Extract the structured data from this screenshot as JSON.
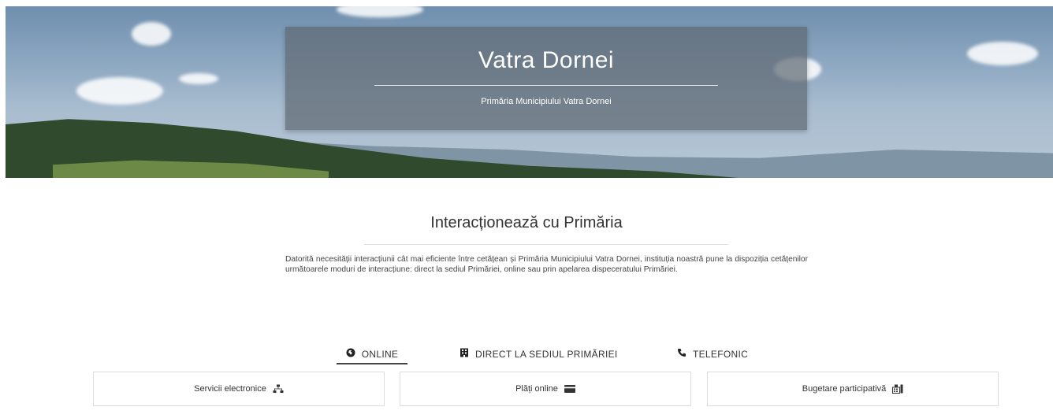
{
  "hero": {
    "title": "Vatra Dornei",
    "subtitle": "Primăria Municipiului Vatra Dornei"
  },
  "intro": {
    "title": "Interacționează cu Primăria",
    "text": "Datorită necesității interacțiunii cât mai eficiente între cetățean și Primăria Municipiului Vatra Dornei, instituția noastră pune la dispoziția cetățenilor următoarele moduri de interacțiune: direct la sediul Primăriei, online sau prin apelarea dispeceratului Primăriei."
  },
  "tabs": [
    {
      "label": "ONLINE",
      "icon": "globe-icon",
      "active": true
    },
    {
      "label": "DIRECT LA SEDIUL PRIMĂRIEI",
      "icon": "building-icon",
      "active": false
    },
    {
      "label": "TELEFONIC",
      "icon": "phone-icon",
      "active": false
    }
  ],
  "cards": [
    {
      "label": "Servicii electronice",
      "icon": "network-icon"
    },
    {
      "label": "Plăți online",
      "icon": "credit-card-icon"
    },
    {
      "label": "Bugetare participativă",
      "icon": "ballot-icon"
    }
  ]
}
